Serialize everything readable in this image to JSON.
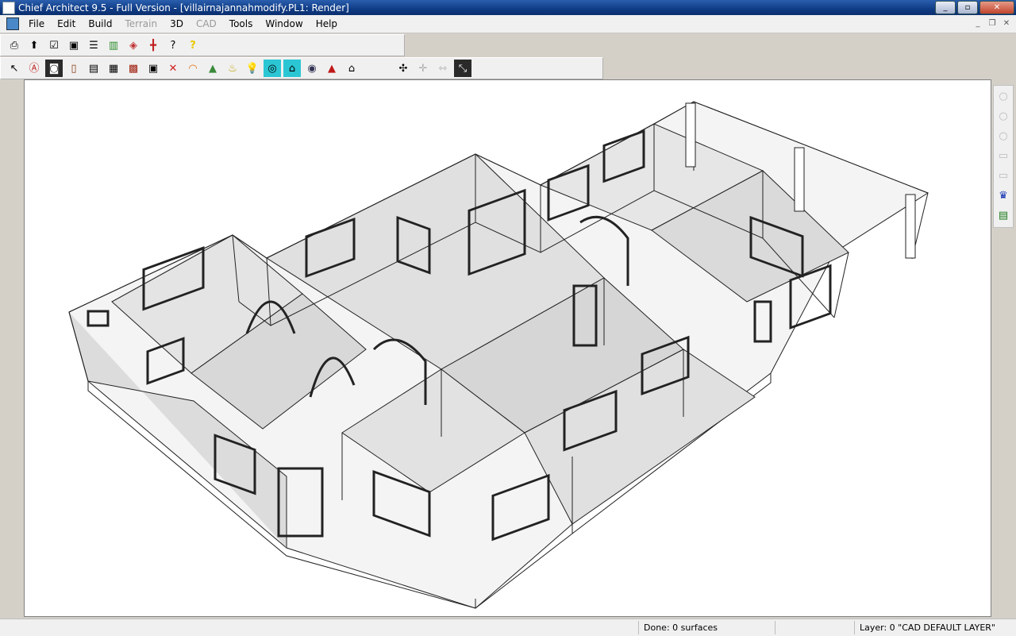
{
  "window": {
    "title": "Chief Architect 9.5 - Full Version - [villairnajannahmodify.PL1: Render]",
    "controls": [
      "_",
      "▫",
      "✕"
    ]
  },
  "menubar": {
    "items": [
      {
        "label": "File",
        "enabled": true
      },
      {
        "label": "Edit",
        "enabled": true
      },
      {
        "label": "Build",
        "enabled": true
      },
      {
        "label": "Terrain",
        "enabled": false
      },
      {
        "label": "3D",
        "enabled": true
      },
      {
        "label": "CAD",
        "enabled": false
      },
      {
        "label": "Tools",
        "enabled": true
      },
      {
        "label": "Window",
        "enabled": true
      },
      {
        "label": "Help",
        "enabled": true
      }
    ],
    "mdi_controls": [
      "_",
      "❐",
      "✕"
    ]
  },
  "toolbar1": {
    "buttons": [
      {
        "icon": "print-icon",
        "glyph": "⎙"
      },
      {
        "icon": "up-arrow-icon",
        "glyph": "⬆"
      },
      {
        "icon": "checkbox-icon",
        "glyph": "☑"
      },
      {
        "icon": "monitor-icon",
        "glyph": "▣"
      },
      {
        "icon": "list-icon",
        "glyph": "☰"
      },
      {
        "icon": "library-icon",
        "glyph": "▥"
      },
      {
        "icon": "paint-icon",
        "glyph": "◈"
      },
      {
        "icon": "axis-icon",
        "glyph": "╋"
      },
      {
        "icon": "info-icon",
        "glyph": "?"
      },
      {
        "icon": "help-icon",
        "glyph": "?"
      }
    ]
  },
  "toolbar2": {
    "buttons": [
      {
        "icon": "select-arrow-icon",
        "glyph": "↖",
        "pressed": false
      },
      {
        "icon": "wall-tool-icon",
        "glyph": "Ⓐ",
        "pressed": false
      },
      {
        "icon": "cabinet-icon",
        "glyph": "◙",
        "pressed": true
      },
      {
        "icon": "door-icon",
        "glyph": "▯",
        "pressed": false
      },
      {
        "icon": "window-tool-icon",
        "glyph": "▤",
        "pressed": false
      },
      {
        "icon": "box-icon",
        "glyph": "▦",
        "pressed": false
      },
      {
        "icon": "fireplace-icon",
        "glyph": "▩",
        "pressed": false
      },
      {
        "icon": "fixture-icon",
        "glyph": "▣",
        "pressed": false
      },
      {
        "icon": "cross-section-icon",
        "glyph": "✕",
        "pressed": false
      },
      {
        "icon": "rainbow-icon",
        "glyph": "◠",
        "pressed": false
      },
      {
        "icon": "blocks-icon",
        "glyph": "▲",
        "pressed": false
      },
      {
        "icon": "lamp-icon",
        "glyph": "♨",
        "pressed": false
      },
      {
        "icon": "bulb-icon",
        "glyph": "💡",
        "pressed": false
      },
      {
        "icon": "sun-toggle-icon",
        "glyph": "◎",
        "pressed": false,
        "cyan": true
      },
      {
        "icon": "house-view-icon",
        "glyph": "⌂",
        "pressed": false,
        "cyan": true
      },
      {
        "icon": "camera-icon",
        "glyph": "◉",
        "pressed": false
      },
      {
        "icon": "roof-icon",
        "glyph": "▲",
        "pressed": false
      },
      {
        "icon": "house-outline-icon",
        "glyph": "⌂",
        "pressed": false
      }
    ],
    "buttons_right": [
      {
        "icon": "tripod-icon",
        "glyph": "✣",
        "pressed": false
      },
      {
        "icon": "move-disabled-icon",
        "glyph": "✛",
        "pressed": false
      },
      {
        "icon": "walk-disabled-icon",
        "glyph": "⇿",
        "pressed": false
      },
      {
        "icon": "mouse-orbit-icon",
        "glyph": "⤡",
        "pressed": true
      }
    ]
  },
  "right_toolbar": {
    "buttons": [
      {
        "icon": "circle-icon",
        "glyph": "○",
        "active": false
      },
      {
        "icon": "circle-icon",
        "glyph": "○",
        "active": false
      },
      {
        "icon": "circle-icon",
        "glyph": "○",
        "active": false
      },
      {
        "icon": "rectangle-icon",
        "glyph": "▭",
        "active": false
      },
      {
        "icon": "rectangle-icon",
        "glyph": "▭",
        "active": false
      },
      {
        "icon": "chess-queen-icon",
        "glyph": "♛",
        "active": true
      },
      {
        "icon": "save-view-icon",
        "glyph": "▤",
        "active": true
      }
    ]
  },
  "statusbar": {
    "cell1": "",
    "cell2": "Done:  0 surfaces",
    "cell3": "",
    "cell4": "Layer: 0  \"CAD DEFAULT LAYER\""
  },
  "view": {
    "name": "3D render of floor plan",
    "render_style": "glass house / wireframe"
  }
}
